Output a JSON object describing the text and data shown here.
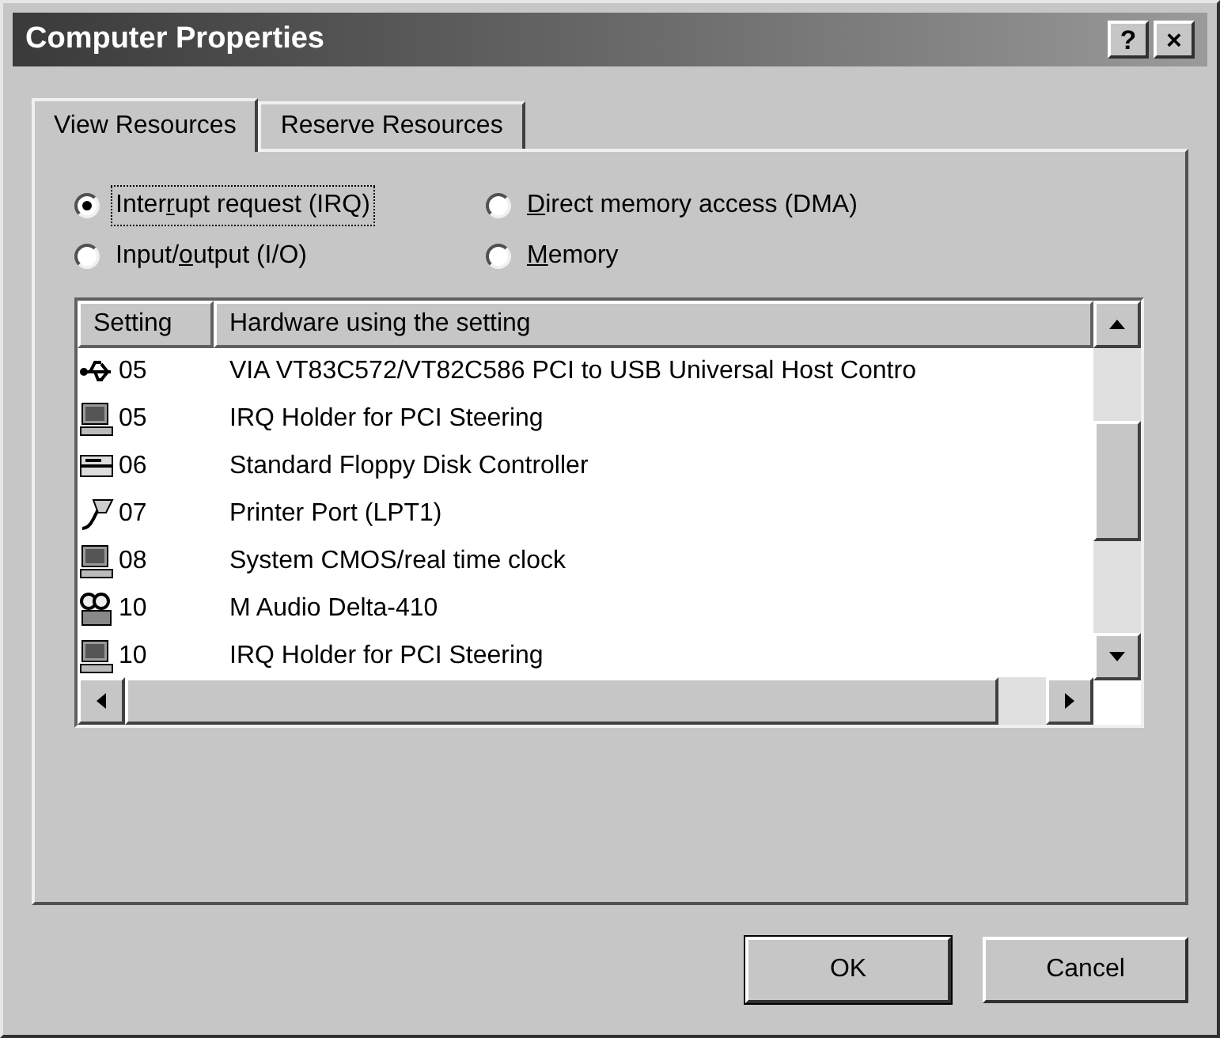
{
  "window": {
    "title": "Computer Properties",
    "title_buttons": [
      "?",
      "×"
    ]
  },
  "tabs": [
    {
      "label": "View Resources",
      "selected": true
    },
    {
      "label": "Reserve Resources",
      "selected": false
    }
  ],
  "radios": [
    {
      "label_parts": {
        "before": "Inter",
        "key": "r",
        "after": "upt request (IRQ)"
      },
      "selected": true,
      "focused": true
    },
    {
      "label_parts": {
        "key": "D",
        "after": "irect memory access (DMA)"
      },
      "selected": false,
      "focused": false
    },
    {
      "label_parts": {
        "before": "Input/",
        "key": "o",
        "after": "utput (I/O)"
      },
      "selected": false,
      "focused": false
    },
    {
      "label_parts": {
        "key": "M",
        "after": "emory"
      },
      "selected": false,
      "focused": false
    }
  ],
  "list": {
    "columns": [
      "Setting",
      "Hardware using the setting"
    ],
    "rows": [
      {
        "kind": "usb",
        "setting": "05",
        "hardware": "VIA VT83C572/VT82C586 PCI to USB Universal Host Contro"
      },
      {
        "kind": "system",
        "setting": "05",
        "hardware": "IRQ Holder for PCI Steering"
      },
      {
        "kind": "floppy",
        "setting": "06",
        "hardware": "Standard Floppy Disk Controller"
      },
      {
        "kind": "port",
        "setting": "07",
        "hardware": "Printer Port (LPT1)"
      },
      {
        "kind": "system",
        "setting": "08",
        "hardware": "System CMOS/real time clock"
      },
      {
        "kind": "sound",
        "setting": "10",
        "hardware": "M Audio Delta-410"
      },
      {
        "kind": "system",
        "setting": "10",
        "hardware": "IRQ Holder for PCI Steering"
      }
    ]
  },
  "buttons": [
    "OK",
    "Cancel"
  ]
}
